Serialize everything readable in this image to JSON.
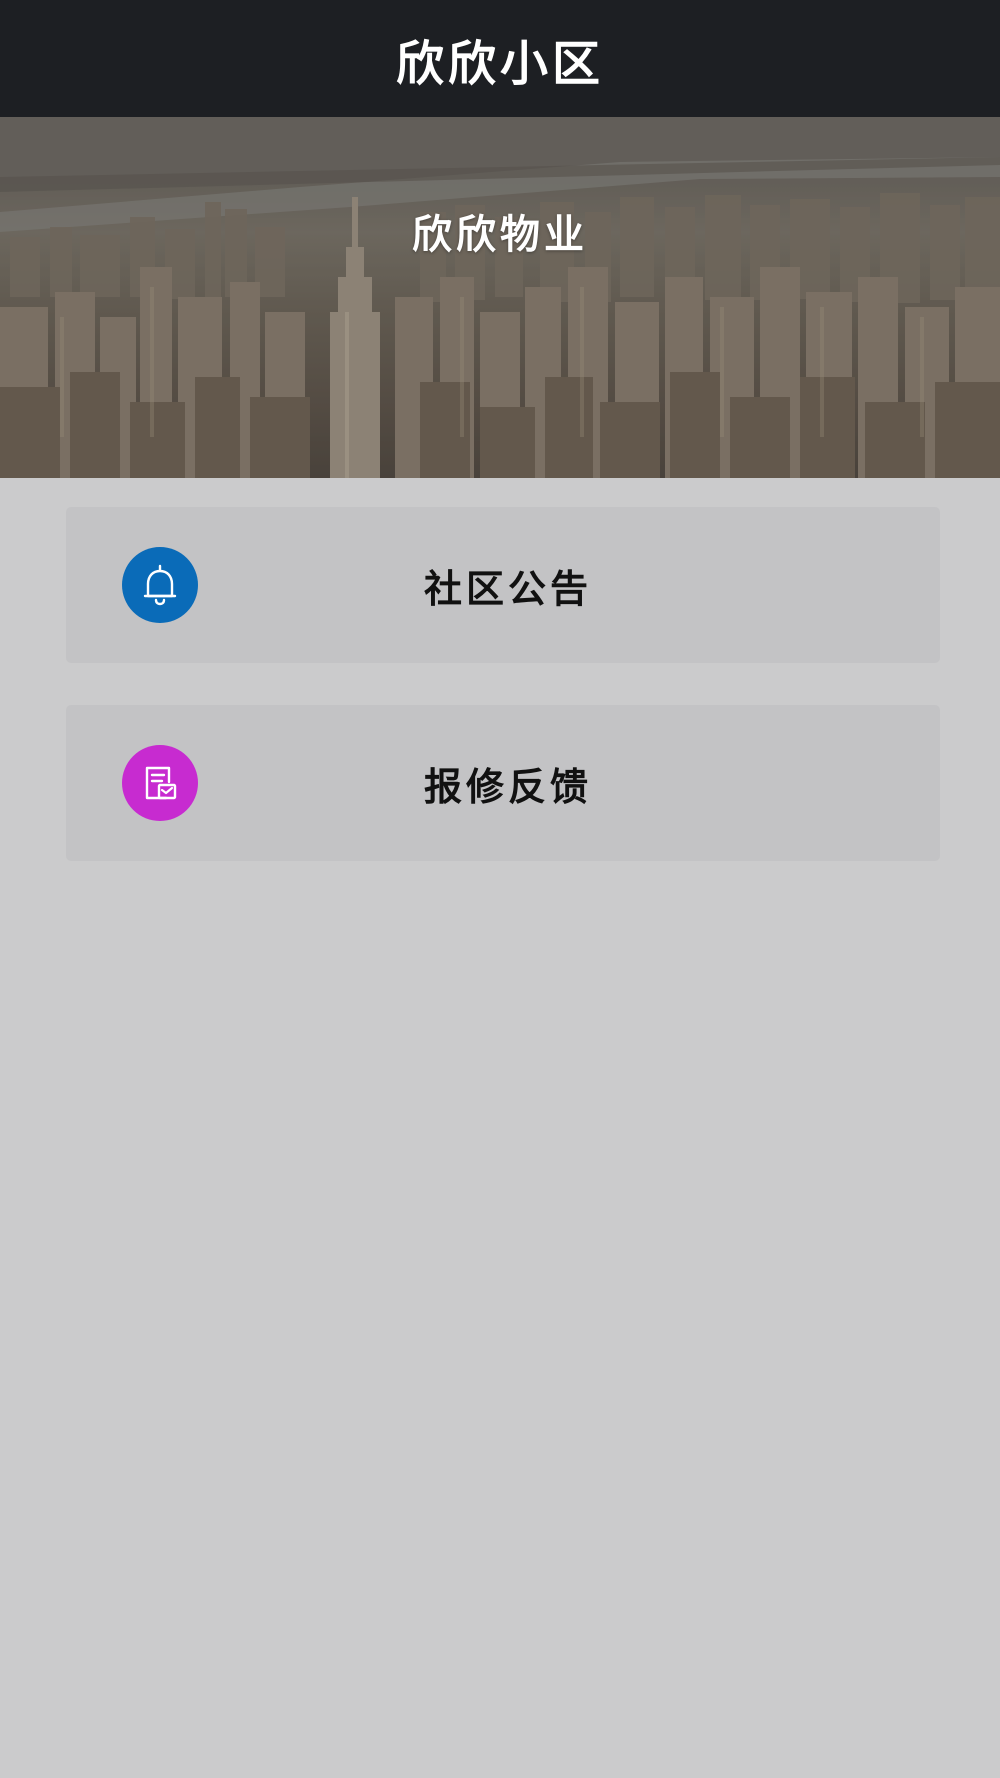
{
  "header": {
    "title": "欣欣小区"
  },
  "banner": {
    "title": "欣欣物业"
  },
  "menu": {
    "items": [
      {
        "label": "社区公告",
        "icon": "bell-icon",
        "icon_color": "#0a6bb8"
      },
      {
        "label": "报修反馈",
        "icon": "repair-form-icon",
        "icon_color": "#c72bd0"
      }
    ]
  },
  "colors": {
    "nav_background": "#1d1f23",
    "page_background": "#cbcbcc",
    "card_background": "#c3c3c5"
  }
}
